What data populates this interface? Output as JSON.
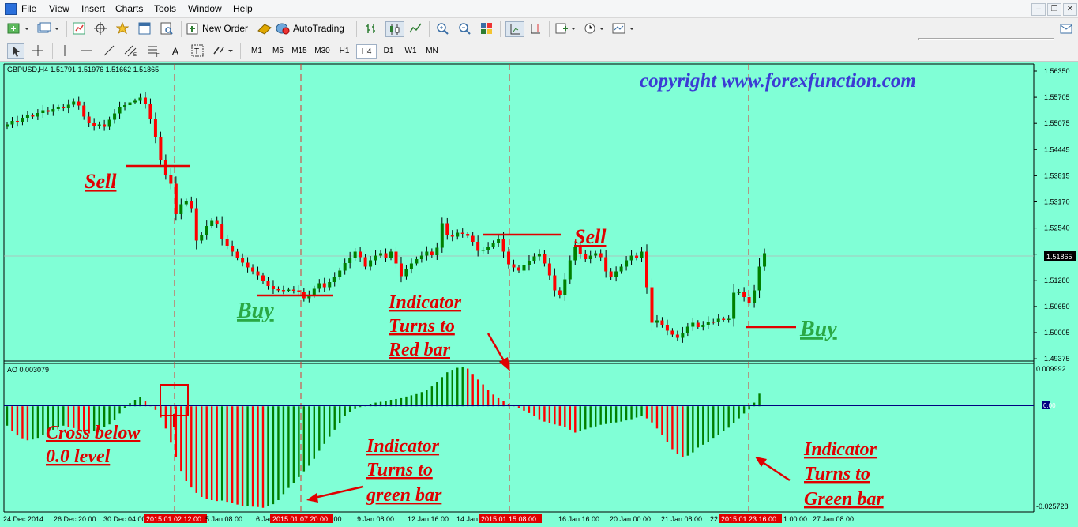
{
  "menu": [
    "File",
    "View",
    "Insert",
    "Charts",
    "Tools",
    "Window",
    "Help"
  ],
  "toolbar": {
    "new_order": "New Order",
    "auto_trading": "AutoTrading"
  },
  "timeframes": [
    "M1",
    "M5",
    "M15",
    "M30",
    "H1",
    "H4",
    "D1",
    "W1",
    "MN"
  ],
  "active_timeframe": "H4",
  "search": {
    "value": "",
    "placeholder": ""
  },
  "colors": {
    "background": "#80ffd6",
    "bull": "#008000",
    "bear": "#ff0000",
    "zero_line": "#000080",
    "annotation_red": "#e00000",
    "annotation_green": "#2aa844",
    "copyright": "#3b3bd4"
  },
  "chart": {
    "symbol_info": "GBPUSD,H4  1.51791 1.51976 1.51662 1.51865",
    "copyright": "copyright  www.forexfunction.com",
    "price_labels": [
      "1.56350",
      "1.55705",
      "1.55075",
      "1.54445",
      "1.53815",
      "1.53170",
      "1.52540",
      "1.51910",
      "1.51280",
      "1.50650",
      "1.50005",
      "1.49375"
    ],
    "current_price": "1.51865",
    "time_labels": [
      "24 Dec 2014",
      "26 Dec 20:00",
      "30 Dec 04:00",
      "2015.01.02 12:00",
      "5 Jan 08:00",
      "6 Jan",
      "2015.01.07 20:00",
      ":00",
      "9 Jan 08:00",
      "12 Jan 16:00",
      "14 Jan",
      "2015.01.15 08:00",
      "16 Jan 16:00",
      "20 Jan 00:00",
      "21 Jan 08:00",
      "22",
      "2015.01.23 16:00",
      "1 00:00",
      "27 Jan 08:00"
    ],
    "indicator_label": "AO 0.003079",
    "indicator_scale": {
      "top": "0.009992",
      "zero": "0.00",
      "bottom": "-0.025728"
    },
    "annotations": {
      "sell1": "Sell",
      "buy1": "Buy",
      "sell2": "Sell",
      "buy2": "Buy",
      "red_bar": [
        "Indicator",
        "Turns to",
        "Red bar"
      ],
      "cross": [
        "Cross below",
        "0.0 level"
      ],
      "green_bar1": [
        "Indicator",
        "Turns to",
        "green bar"
      ],
      "green_bar2": [
        "Indicator",
        "Turns to",
        "Green bar"
      ]
    }
  },
  "chart_data": {
    "type": "candlestick",
    "symbol": "GBPUSD",
    "timeframe": "H4",
    "price_range": [
      1.4913,
      1.5665
    ],
    "closes": [
      1.5512,
      1.5521,
      1.5518,
      1.5529,
      1.5535,
      1.5532,
      1.5541,
      1.5548,
      1.5544,
      1.5551,
      1.5556,
      1.5553,
      1.5562,
      1.557,
      1.556,
      1.5532,
      1.5515,
      1.5508,
      1.5512,
      1.5506,
      1.5524,
      1.554,
      1.5555,
      1.5561,
      1.5568,
      1.5572,
      1.558,
      1.5565,
      1.5525,
      1.548,
      1.5422,
      1.5385,
      1.5362,
      1.5285,
      1.531,
      1.5318,
      1.53,
      1.5218,
      1.5232,
      1.5255,
      1.5268,
      1.526,
      1.5222,
      1.5205,
      1.519,
      1.5175,
      1.5162,
      1.515,
      1.514,
      1.513,
      1.5115,
      1.5103,
      1.5095,
      1.5093,
      1.5092,
      1.5094,
      1.5092,
      1.5088,
      1.5072,
      1.508,
      1.5096,
      1.511,
      1.51,
      1.5113,
      1.5126,
      1.5142,
      1.5161,
      1.5175,
      1.519,
      1.5176,
      1.5152,
      1.5168,
      1.518,
      1.5186,
      1.5175,
      1.519,
      1.516,
      1.5128,
      1.5146,
      1.516,
      1.5171,
      1.518,
      1.519,
      1.5181,
      1.52,
      1.5262,
      1.5232,
      1.5228,
      1.5238,
      1.5235,
      1.523,
      1.5215,
      1.5192,
      1.5195,
      1.5203,
      1.5212,
      1.5222,
      1.519,
      1.5158,
      1.515,
      1.5142,
      1.5155,
      1.5167,
      1.5178,
      1.5185,
      1.516,
      1.513,
      1.5092,
      1.508,
      1.512,
      1.5168,
      1.5203,
      1.5185,
      1.5171,
      1.518,
      1.5186,
      1.5176,
      1.514,
      1.5126,
      1.514,
      1.5152,
      1.5168,
      1.518,
      1.5175,
      1.519,
      1.51,
      1.501,
      1.5016,
      1.5005,
      1.499,
      1.498,
      1.4972,
      1.4985,
      1.5,
      1.501,
      1.4999,
      1.5005,
      1.5013,
      1.5012,
      1.502,
      1.5018,
      1.502,
      1.5086,
      1.5088,
      1.5075,
      1.506,
      1.5092,
      1.5152,
      1.5186
    ],
    "ao_range": [
      -0.025728,
      0.009992
    ],
    "ao_values": [
      -0.0048,
      -0.0061,
      -0.0072,
      -0.0079,
      -0.0084,
      -0.0082,
      -0.0078,
      -0.0071,
      -0.0064,
      -0.0058,
      -0.0052,
      -0.0048,
      -0.0052,
      -0.0054,
      -0.0058,
      -0.0063,
      -0.0067,
      -0.0061,
      -0.0058,
      -0.0052,
      -0.0045,
      -0.0034,
      -0.0018,
      -0.0005,
      0.0008,
      0.0016,
      0.0022,
      0.0012,
      0.0002,
      -0.0009,
      -0.0028,
      -0.0055,
      -0.009,
      -0.0125,
      -0.016,
      -0.0185,
      -0.0201,
      -0.0214,
      -0.0224,
      -0.023,
      -0.0232,
      -0.0234,
      -0.0233,
      -0.0236,
      -0.0239,
      -0.0243,
      -0.0246,
      -0.0246,
      -0.0248,
      -0.0249,
      -0.0251,
      -0.0247,
      -0.0242,
      -0.0232,
      -0.0217,
      -0.0202,
      -0.0189,
      -0.0175,
      -0.0161,
      -0.0147,
      -0.013,
      -0.011,
      -0.0093,
      -0.0075,
      -0.0058,
      -0.0041,
      -0.0025,
      -0.0015,
      -0.0007,
      -0.0002,
      0.0003,
      0.0006,
      0.0009,
      0.0011,
      0.0013,
      0.0016,
      0.0018,
      0.002,
      0.0024,
      0.0027,
      0.003,
      0.0035,
      0.0041,
      0.0049,
      0.006,
      0.0072,
      0.0084,
      0.009,
      0.0095,
      0.0097,
      0.0093,
      0.008,
      0.0066,
      0.0054,
      0.004,
      0.0029,
      0.002,
      0.0014,
      0.0006,
      0.0002,
      -0.0004,
      -0.0011,
      -0.0017,
      -0.0024,
      -0.0032,
      -0.0038,
      -0.0041,
      -0.0045,
      -0.0048,
      -0.0052,
      -0.0058,
      -0.0065,
      -0.0062,
      -0.0057,
      -0.0053,
      -0.005,
      -0.0046,
      -0.0044,
      -0.0041,
      -0.004,
      -0.0038,
      -0.0035,
      -0.0032,
      -0.0028,
      -0.0025,
      -0.003,
      -0.004,
      -0.0055,
      -0.007,
      -0.0088,
      -0.0106,
      -0.0118,
      -0.0125,
      -0.0122,
      -0.0114,
      -0.0102,
      -0.0095,
      -0.0088,
      -0.0078,
      -0.007,
      -0.0062,
      -0.0053,
      -0.0042,
      -0.003,
      -0.0018,
      -0.0008,
      0.0009,
      0.0031
    ]
  }
}
